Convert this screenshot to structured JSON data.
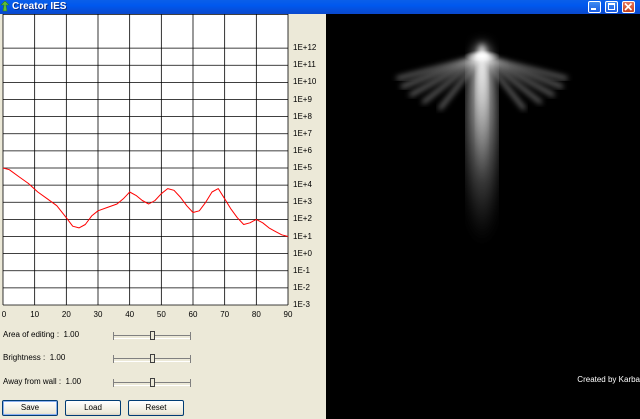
{
  "window": {
    "title": "Creator IES",
    "icon": "app-icon",
    "controls": [
      "minimize-icon",
      "maximize-icon",
      "close-icon"
    ],
    "colors": {
      "titlebar": "#0a5fe9",
      "close": "#c2401d",
      "face": "#ece9d8"
    }
  },
  "chart_data": {
    "type": "line",
    "title": "",
    "xlabel": "",
    "ylabel": "",
    "xlim": [
      0,
      90
    ],
    "ylim": [
      -3,
      13
    ],
    "yscale": "log",
    "grid": true,
    "x_tick_labels": [
      "0",
      "10",
      "20",
      "30",
      "40",
      "50",
      "60",
      "70",
      "80",
      "90"
    ],
    "y_tick_labels": [
      "1E+12",
      "1E+11",
      "1E+10",
      "1E+9",
      "1E+8",
      "1E+7",
      "1E+6",
      "1E+5",
      "1E+4",
      "1E+3",
      "1E+2",
      "1E+1",
      "1E+0",
      "1E-1",
      "1E-2",
      "1E-3"
    ],
    "series": [
      {
        "color": "#ff0000",
        "x": [
          0,
          2,
          5,
          8,
          11,
          14,
          17,
          20,
          22,
          24,
          26,
          28,
          30,
          33,
          36,
          38,
          40,
          42,
          44,
          46,
          48,
          50,
          52,
          54,
          56,
          58,
          60,
          62,
          64,
          66,
          68,
          70,
          72,
          74,
          76,
          78,
          80,
          82,
          84,
          86,
          88,
          90
        ],
        "y": [
          5.0,
          4.9,
          4.5,
          4.1,
          3.6,
          3.2,
          2.8,
          2.1,
          1.6,
          1.5,
          1.7,
          2.2,
          2.5,
          2.7,
          2.9,
          3.2,
          3.6,
          3.4,
          3.1,
          2.9,
          3.1,
          3.5,
          3.8,
          3.7,
          3.3,
          2.8,
          2.4,
          2.5,
          3.0,
          3.6,
          3.8,
          3.2,
          2.6,
          2.1,
          1.7,
          1.8,
          2.0,
          1.8,
          1.5,
          1.3,
          1.1,
          1.0
        ]
      }
    ]
  },
  "controls": {
    "sliders": [
      {
        "label": "Area of editing :",
        "value": "1.00",
        "position": 0.5
      },
      {
        "label": "Brightness :",
        "value": "1.00",
        "position": 0.5
      },
      {
        "label": "Away from wall :",
        "value": "1.00",
        "position": 0.5
      }
    ],
    "buttons": {
      "save": "Save",
      "load": "Load",
      "reset": "Reset"
    }
  },
  "render": {
    "credit": "Created by Karba",
    "background": "#000000",
    "light_color": "#ffffff"
  }
}
